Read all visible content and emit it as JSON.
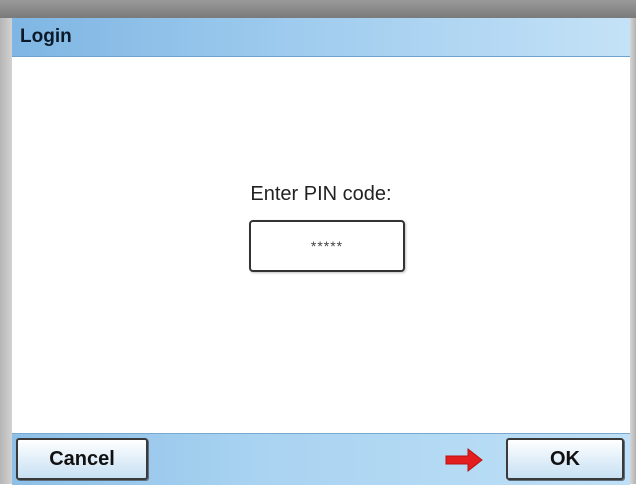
{
  "window": {
    "title": "Login"
  },
  "login": {
    "prompt": "Enter PIN code:",
    "pin_value": "*****"
  },
  "footer": {
    "cancel_label": "Cancel",
    "ok_label": "OK",
    "pointer_icon": "right-arrow-icon",
    "pointer_color": "#e41e1e"
  },
  "colors": {
    "title_bar": "#9ecbee",
    "bottom_bar": "#a9d3f1",
    "frame": "#c2c2c2"
  }
}
